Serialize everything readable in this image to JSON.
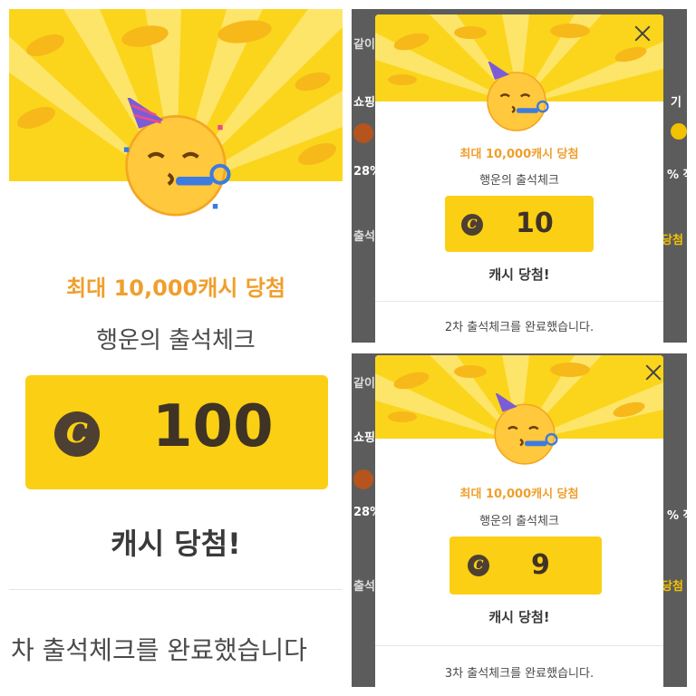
{
  "panels": {
    "large": {
      "headline": "최대 10,000캐시 당첨",
      "subtitle": "행운의 출석체크",
      "amount": "100",
      "win_label": "캐시 당첨!",
      "footer": "차 출석체크를 완료했습니다"
    },
    "top_right": {
      "headline": "최대 10,000캐시 당첨",
      "subtitle": "행운의 출석체크",
      "amount": "10",
      "win_label": "캐시 당첨!",
      "footer": "2차 출석체크를 완료했습니다.",
      "bg_fragments": [
        "같이",
        "쇼핑",
        "28%",
        "출석",
        "기",
        "% 적",
        "당첨"
      ]
    },
    "bottom_right": {
      "headline": "최대 10,000캐시 당첨",
      "subtitle": "행운의 출석체크",
      "amount": "9",
      "win_label": "캐시 당첨!",
      "footer": "3차 출석체크를 완료했습니다.",
      "bg_fragments": [
        "같이",
        "쇼핑",
        "28%",
        "출석",
        "% 적",
        "당첨"
      ]
    }
  },
  "coin_symbol": "C",
  "icons": {
    "close": "close-icon",
    "emoji": "partying-face-icon",
    "coin": "cash-coin-icon"
  },
  "colors": {
    "banner_yellow": "#fbd51b",
    "cash_box": "#fbcf13",
    "headline_orange": "#ef9f2d",
    "coin_brown": "#4e3f33",
    "dim_background": "#5c5c5c"
  }
}
